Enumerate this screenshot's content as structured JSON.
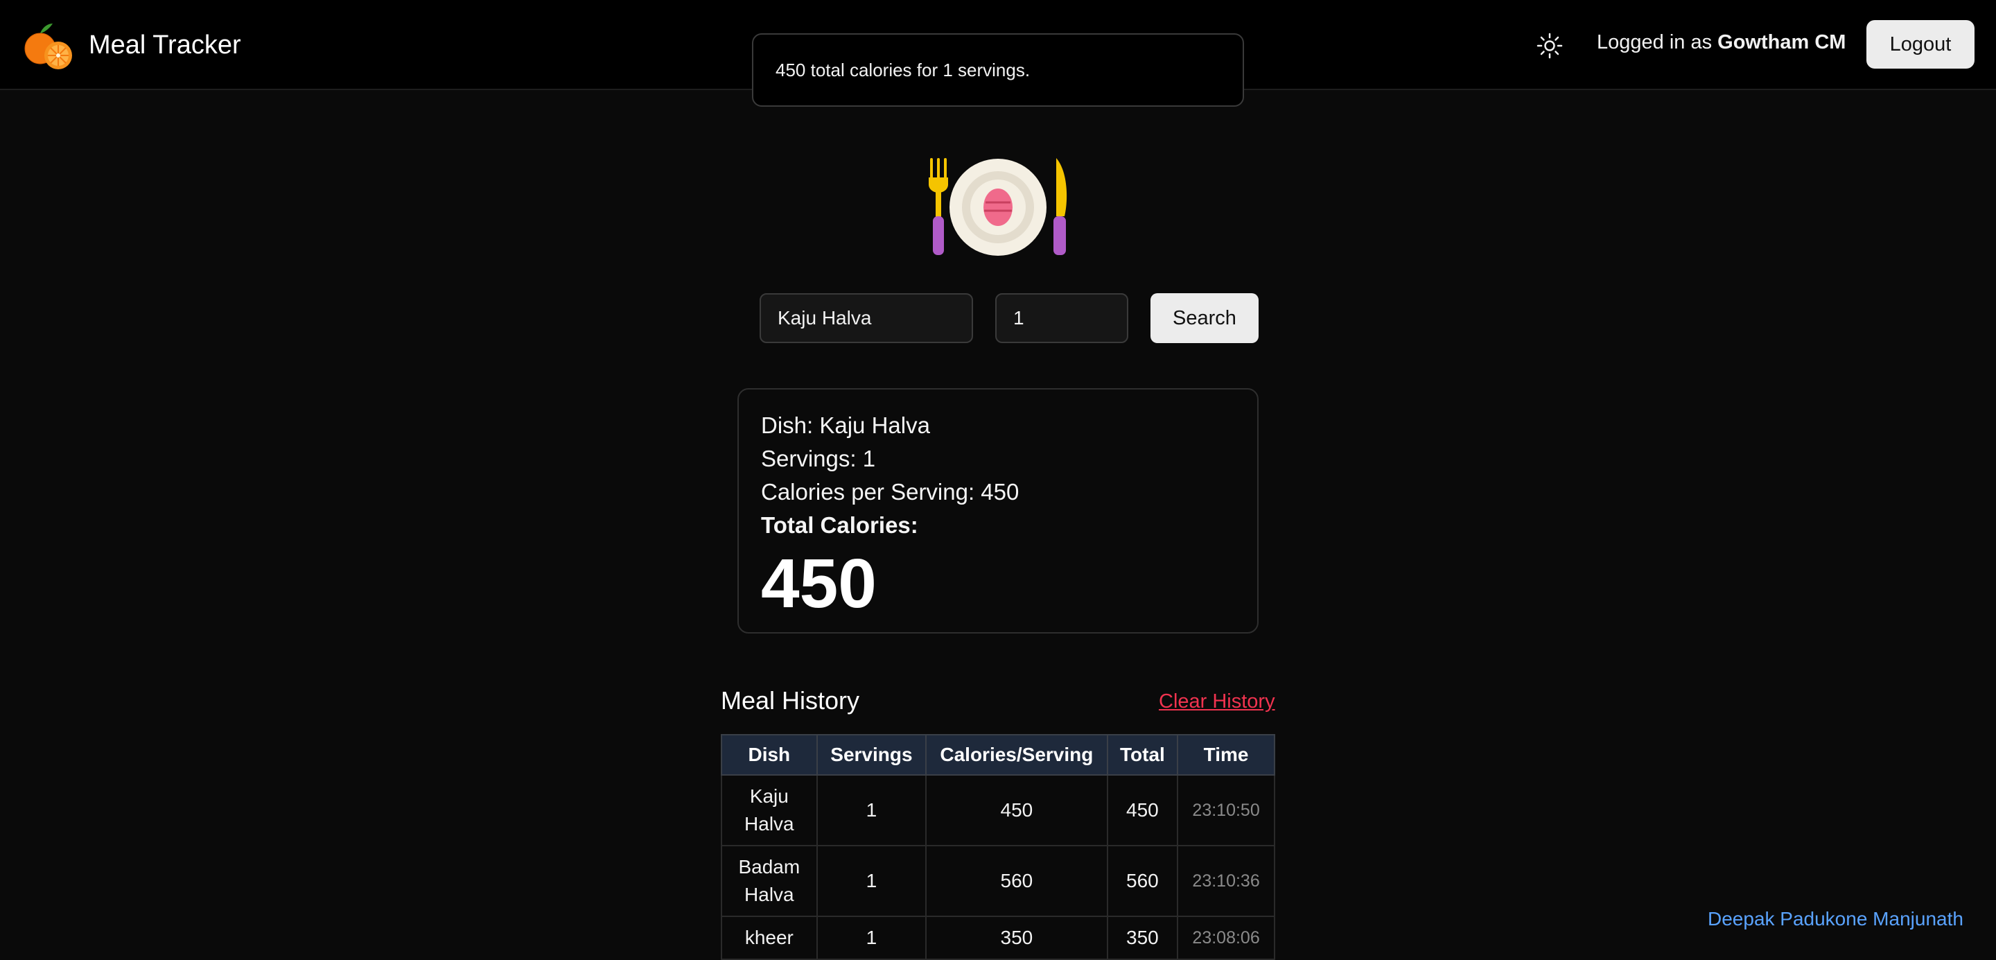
{
  "header": {
    "app_title": "Meal Tracker",
    "logo_icon": "orange-fruit-logo",
    "theme_icon": "sun-icon",
    "login_prefix": "Logged in as",
    "user_name": "Gowtham CM",
    "logout_label": "Logout"
  },
  "toast": {
    "message": "450 total calories for 1 servings."
  },
  "hero_icon": "plate-fork-knife-icon",
  "search": {
    "dish_value": "Kaju Halva",
    "servings_value": "1",
    "button_label": "Search"
  },
  "result": {
    "dish_line": "Dish: Kaju Halva",
    "servings_line": "Servings: 1",
    "calories_line": "Calories per Serving: 450",
    "total_label": "Total Calories:",
    "total_value": "450"
  },
  "history": {
    "title": "Meal History",
    "clear_label": "Clear History",
    "columns": [
      "Dish",
      "Servings",
      "Calories/Serving",
      "Total",
      "Time"
    ],
    "rows": [
      {
        "dish_line1": "Kaju",
        "dish_line2": "Halva",
        "servings": "1",
        "cps": "450",
        "total": "450",
        "time": "23:10:50"
      },
      {
        "dish_line1": "Badam",
        "dish_line2": "Halva",
        "servings": "1",
        "cps": "560",
        "total": "560",
        "time": "23:10:36"
      },
      {
        "dish_line1": "kheer",
        "dish_line2": "",
        "servings": "1",
        "cps": "350",
        "total": "350",
        "time": "23:08:06"
      }
    ]
  },
  "footer": {
    "credit": "Deepak Padukone Manjunath"
  },
  "colors": {
    "accent_red": "#f0334f",
    "link_blue": "#5aa3ff",
    "table_header": "#1e293b"
  }
}
